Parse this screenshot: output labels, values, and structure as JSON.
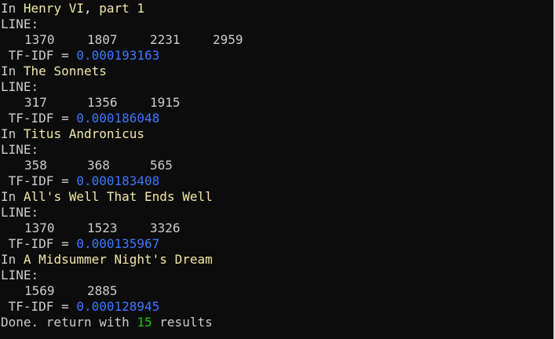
{
  "results": [
    {
      "prefix": "In ",
      "title": "Henry VI, part 1",
      "line_label": "LINE:",
      "lines": [
        "1370",
        "1807",
        "2231",
        "2959"
      ],
      "tfidf_label": " TF-IDF = ",
      "tfidf": "0.000193163"
    },
    {
      "prefix": "In ",
      "title": "The Sonnets",
      "line_label": "LINE:",
      "lines": [
        "317",
        "1356",
        "1915"
      ],
      "tfidf_label": " TF-IDF = ",
      "tfidf": "0.000186048"
    },
    {
      "prefix": "In ",
      "title": "Titus Andronicus",
      "line_label": "LINE:",
      "lines": [
        "358",
        "368",
        "565"
      ],
      "tfidf_label": " TF-IDF = ",
      "tfidf": "0.000183408"
    },
    {
      "prefix": "In ",
      "title": "All's Well That Ends Well",
      "line_label": "LINE:",
      "lines": [
        "1370",
        "1523",
        "3326"
      ],
      "tfidf_label": " TF-IDF = ",
      "tfidf": "0.000135967"
    },
    {
      "prefix": "In ",
      "title": "A Midsummer Night's Dream",
      "line_label": "LINE:",
      "lines": [
        "1569",
        "2885"
      ],
      "tfidf_label": " TF-IDF = ",
      "tfidf": "0.000128945"
    }
  ],
  "footer": {
    "prefix": "Done. return with ",
    "count": "15",
    "suffix": " results"
  },
  "colors": {
    "background": "#0c0c0c",
    "title": "#f2e7a8",
    "text": "#cccccc",
    "tfidf_value": "#3b78ff",
    "count": "#16c60c"
  }
}
